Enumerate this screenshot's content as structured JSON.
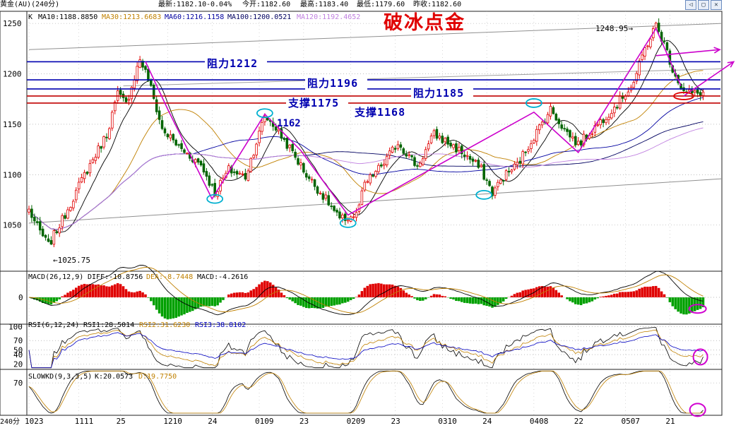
{
  "header": {
    "instrument": "黄金(AU)(240分)",
    "latest": "最新:1182.10",
    "change": "-0.04%",
    "open": "今开:1182.60",
    "high": "最高:1183.40",
    "low": "最低:1179.60",
    "prev_close": "昨收:1182.60",
    "window_buttons": [
      "◁",
      "▢",
      "✕"
    ]
  },
  "overlay_title": "破冰点金",
  "colors": {
    "up": "#e00000",
    "down": "#006400",
    "ma10": "#000000",
    "ma30": "#c08000",
    "ma60": "#0000a0",
    "ma100": "#000060",
    "ma120": "#c080e0",
    "resistance": "#0000b0",
    "support": "#c00000",
    "wave": "#cc00cc",
    "cyan_mark": "#00b0d0",
    "magenta_mark": "#d000d0",
    "red_mark": "#e00000",
    "grid": "#999999"
  },
  "chart_data": [
    {
      "type": "candlestick",
      "panel": "price",
      "legend": {
        "k": "K",
        "ma10": "MA10:1188.8850",
        "ma30": "MA30:1213.6683",
        "ma60": "MA60:1216.1158",
        "ma100": "MA100:1200.0521",
        "ma120": "MA120:1192.4652"
      },
      "ylim": [
        1005,
        1262
      ],
      "y_ticks": [
        1050,
        1100,
        1150,
        1200,
        1250
      ],
      "x_labels": [
        "1023",
        "1111",
        "25",
        "1210",
        "24",
        "0109",
        "23",
        "0209",
        "23",
        "0310",
        "24",
        "0408",
        "22",
        "0507",
        "21"
      ],
      "x_label_index": [
        0,
        18,
        33,
        50,
        66,
        83,
        99,
        116,
        132,
        149,
        165,
        182,
        198,
        215,
        231
      ],
      "n_bars": 244,
      "anchor_closes": [
        [
          0,
          1065
        ],
        [
          3,
          1048
        ],
        [
          7,
          1030
        ],
        [
          12,
          1055
        ],
        [
          20,
          1100
        ],
        [
          28,
          1140
        ],
        [
          32,
          1180
        ],
        [
          35,
          1170
        ],
        [
          40,
          1215
        ],
        [
          43,
          1195
        ],
        [
          48,
          1145
        ],
        [
          55,
          1125
        ],
        [
          62,
          1110
        ],
        [
          67,
          1082
        ],
        [
          72,
          1105
        ],
        [
          78,
          1098
        ],
        [
          85,
          1158
        ],
        [
          88,
          1150
        ],
        [
          95,
          1122
        ],
        [
          100,
          1100
        ],
        [
          108,
          1072
        ],
        [
          112,
          1055
        ],
        [
          118,
          1060
        ],
        [
          121,
          1090
        ],
        [
          128,
          1112
        ],
        [
          133,
          1132
        ],
        [
          140,
          1108
        ],
        [
          146,
          1140
        ],
        [
          152,
          1130
        ],
        [
          158,
          1118
        ],
        [
          163,
          1105
        ],
        [
          167,
          1082
        ],
        [
          171,
          1098
        ],
        [
          176,
          1110
        ],
        [
          182,
          1138
        ],
        [
          188,
          1165
        ],
        [
          193,
          1145
        ],
        [
          198,
          1130
        ],
        [
          205,
          1150
        ],
        [
          212,
          1170
        ],
        [
          218,
          1192
        ],
        [
          222,
          1225
        ],
        [
          226,
          1248
        ],
        [
          229,
          1230
        ],
        [
          232,
          1205
        ],
        [
          236,
          1182
        ],
        [
          240,
          1180
        ],
        [
          243,
          1182
        ]
      ],
      "annotations": {
        "low_label": "1025.75",
        "high_label": "1248.95",
        "swing_label": "1162",
        "resistance_1212": "阻力1212",
        "resistance_1196": "阻力1196",
        "resistance_1185": "阻力1185",
        "support_1175": "支撑1175",
        "support_1168": "支撑1168"
      },
      "levels": [
        {
          "value": 1212,
          "kind": "resistance"
        },
        {
          "value": 1194,
          "kind": "resistance"
        },
        {
          "value": 1185,
          "kind": "resistance"
        },
        {
          "value": 1178,
          "kind": "support"
        },
        {
          "value": 1171,
          "kind": "support"
        }
      ],
      "wave_points": [
        [
          42,
          1212
        ],
        [
          50,
          1165
        ],
        [
          66,
          1076
        ],
        [
          85,
          1160
        ],
        [
          98,
          1124
        ],
        [
          115,
          1060
        ],
        [
          182,
          1162
        ],
        [
          198,
          1122
        ],
        [
          226,
          1245
        ],
        [
          235,
          1188
        ]
      ],
      "projection_arrows": [
        [
          [
            226,
            1218
          ],
          [
            249,
            1224
          ]
        ],
        [
          [
            236,
            1178
          ],
          [
            254,
            1212
          ]
        ]
      ],
      "channel_lines": [
        {
          "from": [
            0,
            1224
          ],
          "to": [
            250,
            1250
          ],
          "color": "#909090"
        },
        {
          "from": [
            0,
            1052
          ],
          "to": [
            250,
            1096
          ],
          "color": "#909090"
        },
        {
          "from": [
            34,
            1188
          ],
          "to": [
            250,
            1205
          ],
          "color": "#a0a0a0"
        }
      ],
      "markers": [
        {
          "kind": "cyan",
          "at": [
            67,
            1076
          ]
        },
        {
          "kind": "cyan",
          "at": [
            85,
            1161
          ]
        },
        {
          "kind": "cyan",
          "at": [
            115,
            1052
          ]
        },
        {
          "kind": "cyan",
          "at": [
            164,
            1080
          ]
        },
        {
          "kind": "cyan",
          "at": [
            182,
            1171
          ]
        },
        {
          "kind": "red",
          "at": [
            236,
            1178
          ]
        }
      ]
    },
    {
      "type": "bar",
      "panel": "macd",
      "legend": {
        "name": "MACD(26,12,9)",
        "diff": "DIFF:-10.8756",
        "dea": "DEA:-8.7448",
        "macd": "MACD:-4.2616"
      },
      "ylim": [
        -25,
        25
      ],
      "y_ticks": [
        0
      ],
      "marker": {
        "kind": "magenta",
        "at": [
          241,
          -11
        ]
      }
    },
    {
      "type": "line",
      "panel": "rsi",
      "legend": {
        "name": "RSI(6,12,24)",
        "rsi1": "RSI1:28.5014",
        "rsi2": "RSI2:31.6230",
        "rsi3": "RSI3:38.8102"
      },
      "ylim": [
        10,
        105
      ],
      "y_ticks": [
        100,
        70,
        50,
        40,
        20
      ],
      "marker": {
        "kind": "magenta",
        "at": [
          242,
          35
        ]
      }
    },
    {
      "type": "line",
      "panel": "kd",
      "legend": {
        "name": "SLOWKD(9,3,3,5)",
        "k": "K:20.0573",
        "d": "D:19.7750"
      },
      "ylim": [
        10,
        95
      ],
      "y_ticks": [
        70
      ],
      "marker": {
        "kind": "magenta",
        "at": [
          241,
          20
        ]
      }
    }
  ],
  "footer": {
    "period": "240分"
  }
}
